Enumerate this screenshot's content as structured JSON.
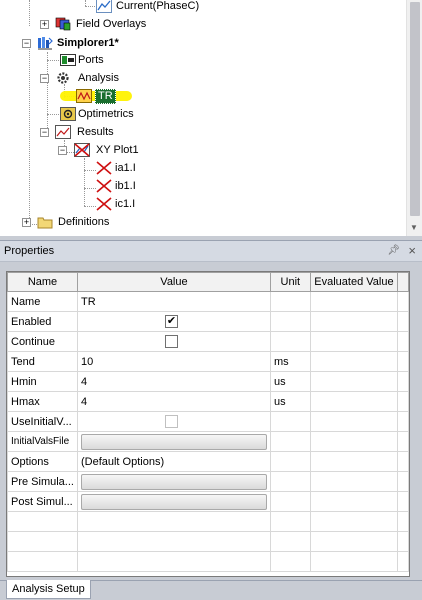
{
  "tree": {
    "items": [
      {
        "label": "Current(PhaseC)"
      },
      {
        "label": "Field Overlays"
      },
      {
        "label": "Simplorer1*"
      },
      {
        "label": "Ports"
      },
      {
        "label": "Analysis"
      },
      {
        "label": "TR"
      },
      {
        "label": "Optimetrics"
      },
      {
        "label": "Results"
      },
      {
        "label": "XY Plot1"
      },
      {
        "label": "ia1.I"
      },
      {
        "label": "ib1.I"
      },
      {
        "label": "ic1.I"
      },
      {
        "label": "Definitions"
      }
    ]
  },
  "properties": {
    "title": "Properties",
    "pin_icon": "pin-icon",
    "close_icon": "close-icon",
    "columns": [
      "Name",
      "Value",
      "Unit",
      "Evaluated Value"
    ],
    "rows": [
      {
        "name": "Name",
        "value": "TR",
        "unit": ""
      },
      {
        "name": "Enabled",
        "checkbox": true,
        "checked": true
      },
      {
        "name": "Continue",
        "checkbox": true,
        "checked": false
      },
      {
        "name": "Tend",
        "value": "10",
        "unit": "ms",
        "highlight": true
      },
      {
        "name": "Hmin",
        "value": "4",
        "unit": "us",
        "highlight": true
      },
      {
        "name": "Hmax",
        "value": "4",
        "unit": "us",
        "highlight": true
      },
      {
        "name": "UseInitialV...",
        "checkbox": true,
        "checked": false,
        "disabled": true
      },
      {
        "name": "InitialValsFile",
        "button": true
      },
      {
        "name": "Options",
        "value": "(Default Options)"
      },
      {
        "name": "Pre Simula...",
        "button": true
      },
      {
        "name": "Post Simul...",
        "button": true
      }
    ],
    "check_mark": "✔"
  },
  "bottom_tabs": [
    {
      "label": "Analysis Setup"
    }
  ],
  "colors": {
    "highlight": "#fff200",
    "panel_bg": "#c8ccd4"
  }
}
